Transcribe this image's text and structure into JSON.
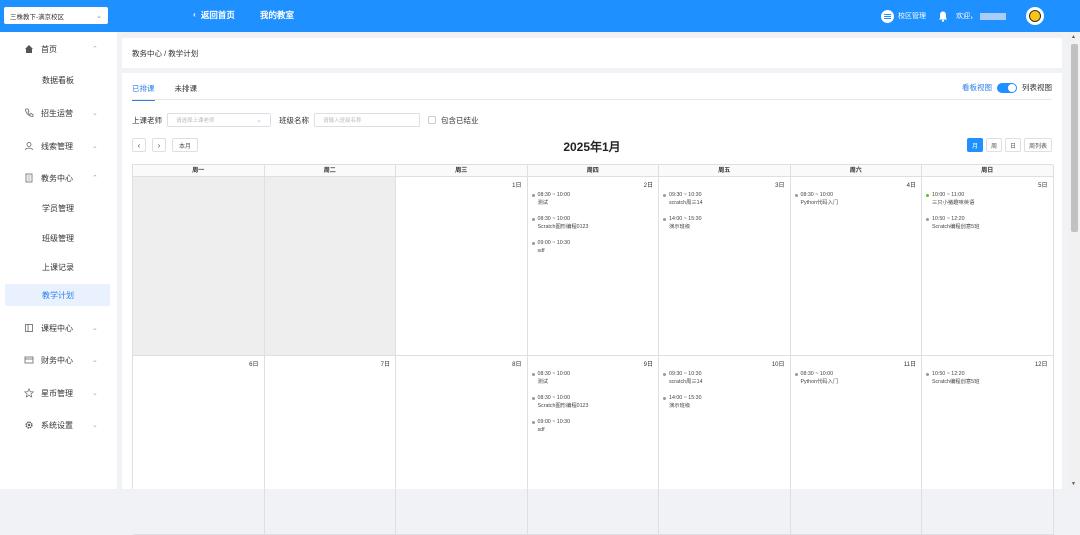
{
  "topbar": {
    "campus": "三株教下-满京校区",
    "back_label": "返回首页",
    "my_classroom": "我的教室",
    "campus_manage": "校区管理",
    "welcome": "欢迎，"
  },
  "sidebar": {
    "items": [
      {
        "label": "首页",
        "icon": "home-icon"
      },
      {
        "label": "数据看板"
      },
      {
        "label": "招生运营",
        "icon": "phone-icon"
      },
      {
        "label": "线索管理",
        "icon": "user-icon"
      },
      {
        "label": "教务中心",
        "icon": "building-icon"
      },
      {
        "label": "学员管理"
      },
      {
        "label": "班级管理"
      },
      {
        "label": "上课记录"
      },
      {
        "label": "教学计划"
      },
      {
        "label": "课程中心",
        "icon": "book-icon"
      },
      {
        "label": "财务中心",
        "icon": "card-icon"
      },
      {
        "label": "星币管理",
        "icon": "star-icon"
      },
      {
        "label": "系统设置",
        "icon": "gear-icon"
      }
    ]
  },
  "breadcrumb": "教务中心 / 教学计划",
  "tabs": [
    "已排课",
    "未排课"
  ],
  "view_switch": {
    "board": "看板视图",
    "list": "列表视图"
  },
  "filters": {
    "teacher_label": "上课老师",
    "teacher_placeholder": "请选择上课老师",
    "class_label": "班级名称",
    "class_placeholder": "请输入班级名称",
    "include_ended": "包含已结业"
  },
  "calendar": {
    "title": "2025年1月",
    "today": "本月",
    "modes": [
      "月",
      "周",
      "日",
      "周列表"
    ],
    "weekdays": [
      "周一",
      "周二",
      "周三",
      "周四",
      "周五",
      "周六",
      "周日"
    ],
    "week1": {
      "days": [
        "",
        "",
        "1日",
        "2日",
        "3日",
        "4日",
        "5日"
      ],
      "events": [
        [],
        [],
        [],
        [
          {
            "time": "08:30 ~ 10:00",
            "name": "测试"
          },
          {
            "time": "08:30 ~ 10:00",
            "name": "Scratch图形编程0123"
          },
          {
            "time": "09:00 ~ 10:30",
            "name": "sdf"
          }
        ],
        [
          {
            "time": "09:30 ~ 10:30",
            "name": "scratch周三14"
          },
          {
            "time": "14:00 ~ 15:30",
            "name": "演示班级"
          }
        ],
        [
          {
            "time": "08:30 ~ 10:00",
            "name": "Python代码入门"
          }
        ],
        [
          {
            "time": "10:00 ~ 11:00",
            "name": "三只小猪趣味英语",
            "green": true
          },
          {
            "time": "10:50 ~ 12:20",
            "name": "Scratch编程创意5班"
          }
        ]
      ]
    },
    "week2": {
      "days": [
        "6日",
        "7日",
        "8日",
        "9日",
        "10日",
        "11日",
        "12日"
      ],
      "events": [
        [],
        [],
        [],
        [
          {
            "time": "08:30 ~ 10:00",
            "name": "测试"
          },
          {
            "time": "08:30 ~ 10:00",
            "name": "Scratch图形编程0123"
          },
          {
            "time": "09:00 ~ 10:30",
            "name": "sdf"
          }
        ],
        [
          {
            "time": "09:30 ~ 10:30",
            "name": "scratch周三14"
          },
          {
            "time": "14:00 ~ 15:30",
            "name": "演示班级"
          }
        ],
        [
          {
            "time": "08:30 ~ 10:00",
            "name": "Python代码入门"
          }
        ],
        [
          {
            "time": "10:50 ~ 12:20",
            "name": "Scratch编程创意5班"
          }
        ]
      ]
    }
  }
}
